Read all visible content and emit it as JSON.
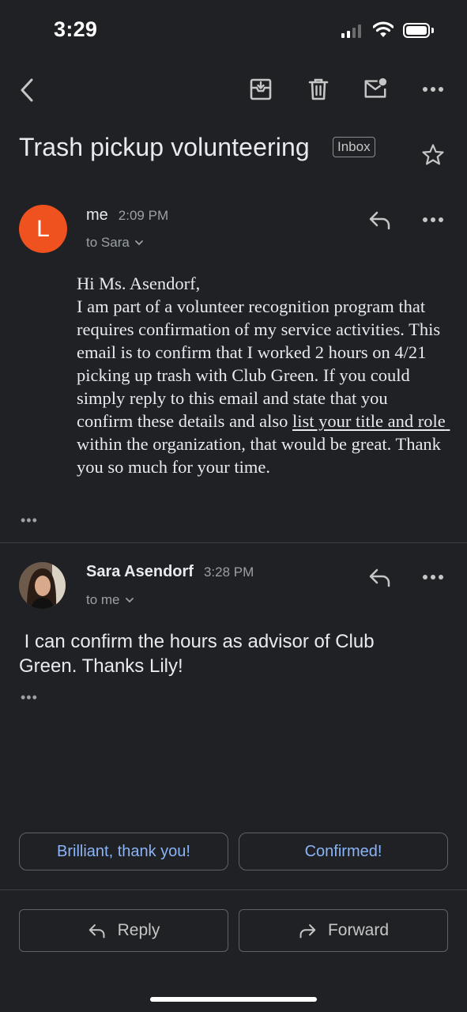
{
  "status_bar": {
    "time": "3:29"
  },
  "header": {
    "subject": "Trash pickup volunteering",
    "label": "Inbox",
    "icons": [
      "back-arrow-icon",
      "archive-icon",
      "trash-icon",
      "mark-unread-icon",
      "more-icon",
      "star-icon"
    ]
  },
  "messages": [
    {
      "avatar_letter": "L",
      "avatar_color": "#f0521f",
      "sender": "me",
      "time": "2:09 PM",
      "recipient": "to Sara",
      "body_part1": "Hi Ms. Asendorf,\nI am part of a volunteer recognition program that requires confirmation of my service activities. This email is to confirm that I worked 2 hours on 4/21 picking up trash with Club Green. If you could simply reply to this email and state that you confirm these details and also ",
      "body_link": "list your title and role ",
      "body_part2": "within the organization, that would be great. Thank you so much for your time.",
      "trimmed": "•••"
    },
    {
      "sender": "Sara Asendorf",
      "time": "3:28 PM",
      "recipient": "to me",
      "body": " I can confirm the hours as advisor of Club Green. Thanks Lily!",
      "trimmed": "•••"
    }
  ],
  "smart_replies": [
    "Brilliant, thank you!",
    "Confirmed!"
  ],
  "actions": {
    "reply": "Reply",
    "forward": "Forward"
  },
  "colors": {
    "background": "#202124",
    "accent": "#8ab4f8"
  }
}
